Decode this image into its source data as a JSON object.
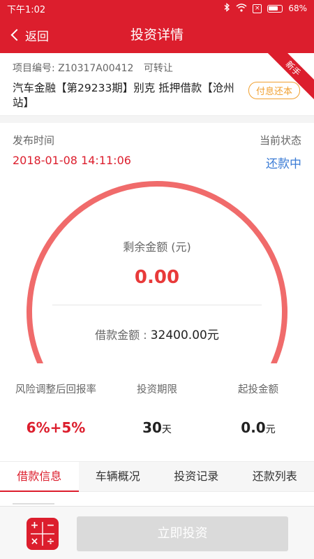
{
  "status_bar": {
    "time": "下午1:02",
    "bluetooth_icon": "bluetooth-icon",
    "wifi_icon": "wifi-icon",
    "sim_icon": "no-sim-icon",
    "battery_percent": "68%"
  },
  "nav": {
    "back_label": "返回",
    "title": "投资详情"
  },
  "project": {
    "code_label": "项目编号:",
    "code_value": "Z10317A00412",
    "transferable": "可转让",
    "name": "汽车金融【第29233期】别克 抵押借款【沧州站】",
    "repayment_type": "付息还本",
    "ribbon": "新手"
  },
  "publish": {
    "label": "发布时间",
    "time": "2018-01-08 14:11:06"
  },
  "state": {
    "label": "当前状态",
    "value": "还款中"
  },
  "gauge": {
    "remaining_label": "剩余金额 (元)",
    "remaining_value": "0.00",
    "loan_label": "借款金额 :",
    "loan_value": "32400.00元",
    "fill_fraction": 1.0,
    "arc_color": "#f06b6b"
  },
  "stats": [
    {
      "label": "风险调整后回报率",
      "value": "6%+5%",
      "unit": ""
    },
    {
      "label": "投资期限",
      "value": "30",
      "unit": "天"
    },
    {
      "label": "起投金额",
      "value": "0.0",
      "unit": "元"
    }
  ],
  "tabs": [
    {
      "label": "借款信息",
      "active": true
    },
    {
      "label": "车辆概况",
      "active": false
    },
    {
      "label": "投资记录",
      "active": false
    },
    {
      "label": "还款列表",
      "active": false
    }
  ],
  "bottom": {
    "calculator_icon": "calculator-icon",
    "calc_symbols": [
      "+",
      "−",
      "×",
      "÷"
    ],
    "invest_label": "立即投资"
  },
  "colors": {
    "brand": "#dc1e2d",
    "accent_blue": "#3a7bd5",
    "badge_orange": "#f0a030"
  }
}
